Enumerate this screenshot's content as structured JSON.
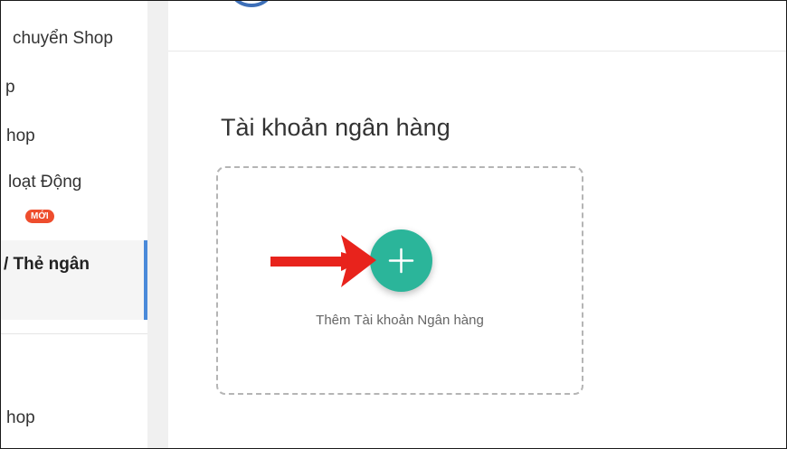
{
  "sidebar": {
    "items": [
      {
        "label": "chuyển Shop"
      },
      {
        "label": "p"
      },
      {
        "label": "hop"
      },
      {
        "label": "loạt Động"
      },
      {
        "label": "/ Thẻ ngân"
      },
      {
        "label": "hop"
      }
    ],
    "badge_new": "MỚI"
  },
  "main": {
    "section_title": "Tài khoản ngân hàng",
    "add_card": {
      "label": "Thêm Tài khoản Ngân hàng",
      "button_icon": "plus-icon"
    },
    "annotation_icon": "red-arrow-icon"
  },
  "colors": {
    "accent_green": "#2bb59a",
    "active_bar_blue": "#4a8ad9",
    "badge_red": "#ee4d2d",
    "arrow_red": "#e8231c"
  }
}
